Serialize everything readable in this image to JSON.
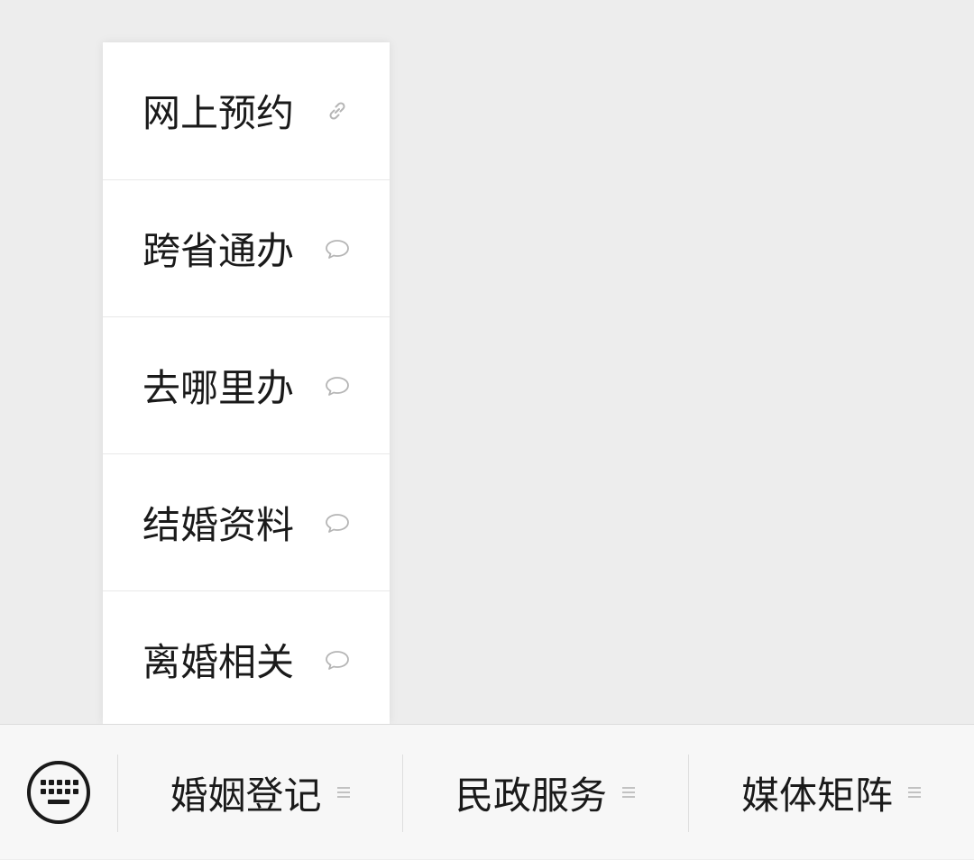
{
  "submenu": {
    "items": [
      {
        "label": "网上预约",
        "icon": "link-icon"
      },
      {
        "label": "跨省通办",
        "icon": "chat-bubble-icon"
      },
      {
        "label": "去哪里办",
        "icon": "chat-bubble-icon"
      },
      {
        "label": "结婚资料",
        "icon": "chat-bubble-icon"
      },
      {
        "label": "离婚相关",
        "icon": "chat-bubble-icon"
      }
    ]
  },
  "bottom_bar": {
    "keyboard_icon": "keyboard-icon",
    "menus": [
      {
        "label": "婚姻登记",
        "icon": "menu-lines-icon"
      },
      {
        "label": "民政服务",
        "icon": "menu-lines-icon"
      },
      {
        "label": "媒体矩阵",
        "icon": "menu-lines-icon"
      }
    ]
  },
  "colors": {
    "background": "#ededed",
    "menu_background": "#ffffff",
    "bar_background": "#f7f7f7",
    "text": "#1a1a1a",
    "icon": "#b5b5b5"
  }
}
